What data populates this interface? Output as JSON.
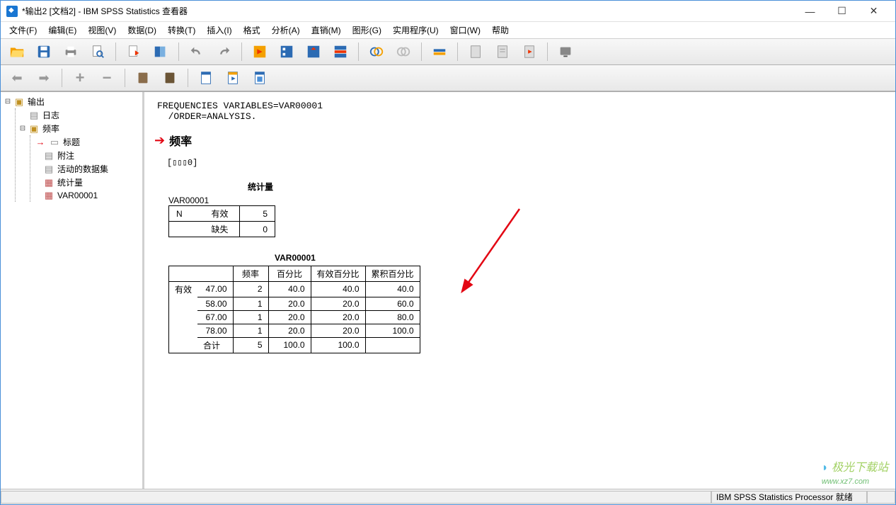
{
  "window": {
    "title": "*输出2 [文档2] - IBM SPSS Statistics 查看器"
  },
  "menu": {
    "file": "文件(F)",
    "edit": "编辑(E)",
    "view": "视图(V)",
    "data": "数据(D)",
    "transform": "转换(T)",
    "insert": "插入(I)",
    "format": "格式",
    "analyze": "分析(A)",
    "direct": "直销(M)",
    "graphs": "图形(G)",
    "utilities": "实用程序(U)",
    "window": "窗口(W)",
    "help": "帮助"
  },
  "tree": {
    "root": "输出",
    "log": "日志",
    "freq": "频率",
    "title": "标题",
    "notes": "附注",
    "active": "活动的数据集",
    "stats": "统计量",
    "var": "VAR00001"
  },
  "output": {
    "syntax_line1": "FREQUENCIES VARIABLES=VAR00001",
    "syntax_line2": "  /ORDER=ANALYSIS.",
    "section_heading": "频率",
    "dataset_text": "[▯▯▯0]",
    "stats_title": "统计量",
    "stats_var": "VAR00001",
    "stats_n": "N",
    "stats_valid": "有效",
    "stats_valid_val": "5",
    "stats_missing": "缺失",
    "stats_missing_val": "0",
    "freq_title": "VAR00001",
    "freq_headers": {
      "h1": "频率",
      "h2": "百分比",
      "h3": "有效百分比",
      "h4": "累积百分比"
    },
    "freq_valid_label": "有效",
    "freq_total_label": "合计",
    "freq_rows": [
      {
        "val": "47.00",
        "freq": "2",
        "pct": "40.0",
        "vpct": "40.0",
        "cpct": "40.0"
      },
      {
        "val": "58.00",
        "freq": "1",
        "pct": "20.0",
        "vpct": "20.0",
        "cpct": "60.0"
      },
      {
        "val": "67.00",
        "freq": "1",
        "pct": "20.0",
        "vpct": "20.0",
        "cpct": "80.0"
      },
      {
        "val": "78.00",
        "freq": "1",
        "pct": "20.0",
        "vpct": "20.0",
        "cpct": "100.0"
      }
    ],
    "freq_total": {
      "freq": "5",
      "pct": "100.0",
      "vpct": "100.0",
      "cpct": ""
    }
  },
  "status": {
    "processor": "IBM SPSS Statistics Processor 就绪"
  },
  "watermark": {
    "text": "极光下载站",
    "url": "www.xz7.com"
  }
}
